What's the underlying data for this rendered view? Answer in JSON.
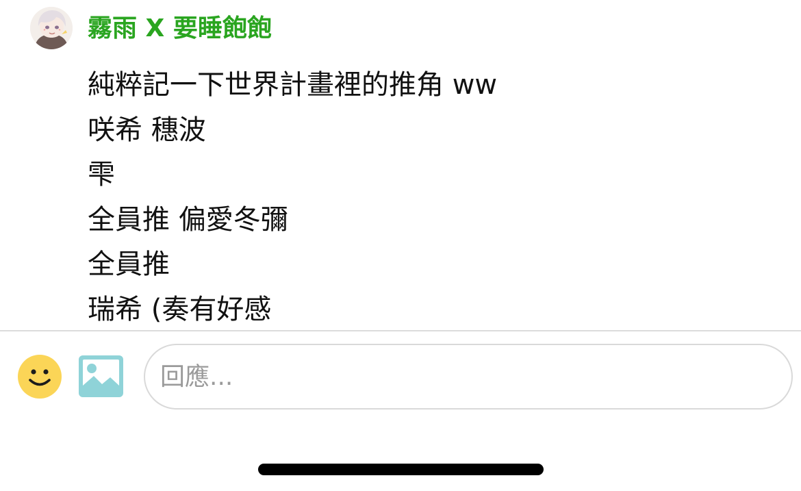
{
  "comment": {
    "author": "霧雨 X 要睡飽飽",
    "author_color": "#2aa520",
    "avatar_icon": "anime-avatar-icon",
    "lines": [
      "純粹記一下世界計畫裡的推角 ww",
      "咲希 穗波",
      "雫",
      "全員推 偏愛冬彌",
      "全員推",
      "瑞希 (奏有好感"
    ]
  },
  "reply_bar": {
    "emoji_icon": "smiley-face-icon",
    "image_icon": "image-picture-icon",
    "placeholder": "回應...",
    "value": ""
  }
}
